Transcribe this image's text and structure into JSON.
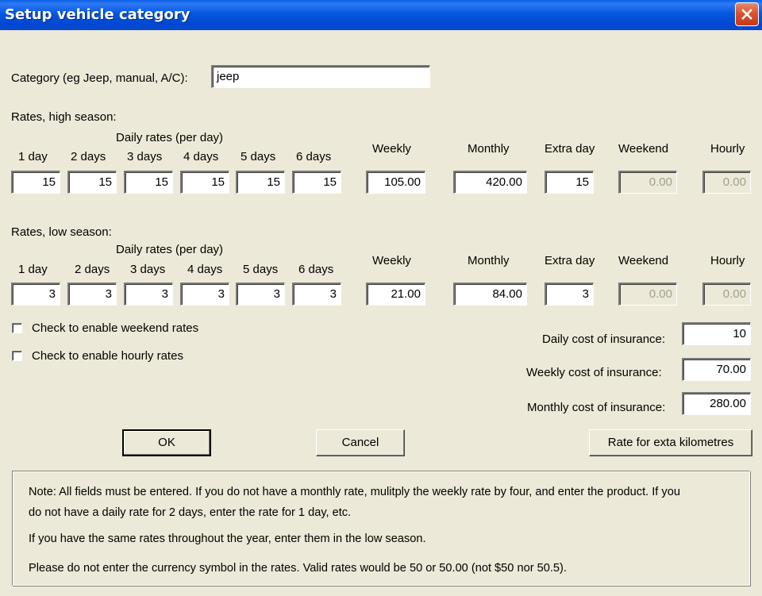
{
  "window": {
    "title": "Setup vehicle category"
  },
  "category": {
    "label": "Category (eg Jeep, manual, A/C):",
    "value": "jeep"
  },
  "columns": {
    "daily_header": "Daily rates (per day)",
    "day1": "1 day",
    "day2": "2 days",
    "day3": "3 days",
    "day4": "4 days",
    "day5": "5 days",
    "day6": "6 days",
    "weekly": "Weekly",
    "monthly": "Monthly",
    "extra_day": "Extra day",
    "weekend": "Weekend",
    "hourly": "Hourly"
  },
  "high_season": {
    "label": "Rates, high season:",
    "day1": "15",
    "day2": "15",
    "day3": "15",
    "day4": "15",
    "day5": "15",
    "day6": "15",
    "weekly": "105.00",
    "monthly": "420.00",
    "extra_day": "15",
    "weekend": "0.00",
    "hourly": "0.00"
  },
  "low_season": {
    "label": "Rates, low season:",
    "day1": "3",
    "day2": "3",
    "day3": "3",
    "day4": "3",
    "day5": "3",
    "day6": "3",
    "weekly": "21.00",
    "monthly": "84.00",
    "extra_day": "3",
    "weekend": "0.00",
    "hourly": "0.00"
  },
  "options": {
    "weekend_label": "Check to enable weekend rates",
    "hourly_label": "Check to enable hourly rates"
  },
  "insurance": {
    "daily_label": "Daily cost of insurance:",
    "daily_value": "10",
    "weekly_label": "Weekly cost of insurance:",
    "weekly_value": "70.00",
    "monthly_label": "Monthly cost of insurance:",
    "monthly_value": "280.00"
  },
  "buttons": {
    "ok": "OK",
    "cancel": "Cancel",
    "extra_km": "Rate for exta kilometres"
  },
  "notes": {
    "line1": "Note:  All fields must be entered.  If you do not have a monthly rate, mulitply the weekly rate by four, and enter the product.  If you",
    "line2": "do not have a daily rate for 2 days, enter  the rate for 1 day, etc.",
    "line3": "If you have the same rates throughout the year, enter them in the low season.",
    "line4": "Please do not enter the currency symbol in the rates.  Valid rates would be 50 or 50.00 (not $50 nor 50.5)."
  }
}
